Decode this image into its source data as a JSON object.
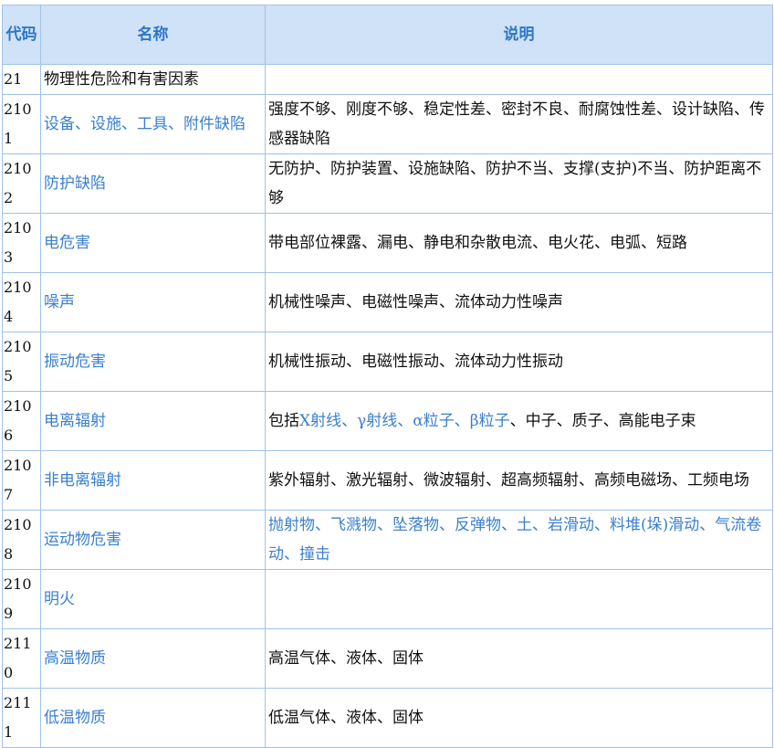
{
  "header": {
    "code": "代码",
    "name": "名称",
    "desc": "说明"
  },
  "rows": [
    {
      "code": "21",
      "name": "物理性危险和有害因素",
      "desc": "",
      "name_color": "plain",
      "lines": 1
    },
    {
      "code": "2101",
      "name": "设备、设施、工具、附件缺陷",
      "desc": "强度不够、刚度不够、稳定性差、密封不良、耐腐蚀性差、设计缺陷、传感器缺陷",
      "name_color": "blue",
      "lines": 2
    },
    {
      "code": "2102",
      "name": "防护缺陷",
      "desc": "无防护、防护装置、设施缺陷、防护不当、支撑(支护)不当、防护距离不够",
      "name_color": "blue",
      "lines": 2
    },
    {
      "code": "2103",
      "name": "电危害",
      "desc": "带电部位裸露、漏电、静电和杂散电流、电火花、电弧、短路",
      "name_color": "blue",
      "lines": 1
    },
    {
      "code": "2104",
      "name": "噪声",
      "desc": "机械性噪声、电磁性噪声、流体动力性噪声",
      "name_color": "blue",
      "lines": 1
    },
    {
      "code": "2105",
      "name": "振动危害",
      "desc": "机械性振动、电磁性振动、流体动力性振动",
      "name_color": "blue",
      "lines": 1
    },
    {
      "code": "2106",
      "name": "电离辐射",
      "desc_prefix": "包括",
      "desc_blue": "X射线、γ射线、α粒子、β粒子",
      "desc_suffix": "、中子、质子、高能电子束",
      "name_color": "blue",
      "lines": 1
    },
    {
      "code": "2107",
      "name": "非电离辐射",
      "desc": "紫外辐射、激光辐射、微波辐射、超高频辐射、高频电磁场、工频电场",
      "name_color": "blue",
      "lines": 2
    },
    {
      "code": "2108",
      "name": "运动物危害",
      "desc": "抛射物、飞溅物、坠落物、反弹物、土、岩滑动、料堆(垛)滑动、气流卷动、撞击",
      "name_color": "blue",
      "desc_color": "blue",
      "lines": 2
    },
    {
      "code": "2109",
      "name": "明火",
      "desc": "",
      "name_color": "blue",
      "lines": 1
    },
    {
      "code": "2110",
      "name": "高温物质",
      "desc": "高温气体、液体、固体",
      "name_color": "blue",
      "lines": 1
    },
    {
      "code": "2111",
      "name": "低温物质",
      "desc": "低温气体、液体、固体",
      "name_color": "blue",
      "lines": 1
    }
  ],
  "colors": {
    "header_bg": "#cfe2f7",
    "header_text": "#2f76c7",
    "border": "#9fc3e8",
    "link_blue": "#3a7fd0"
  }
}
